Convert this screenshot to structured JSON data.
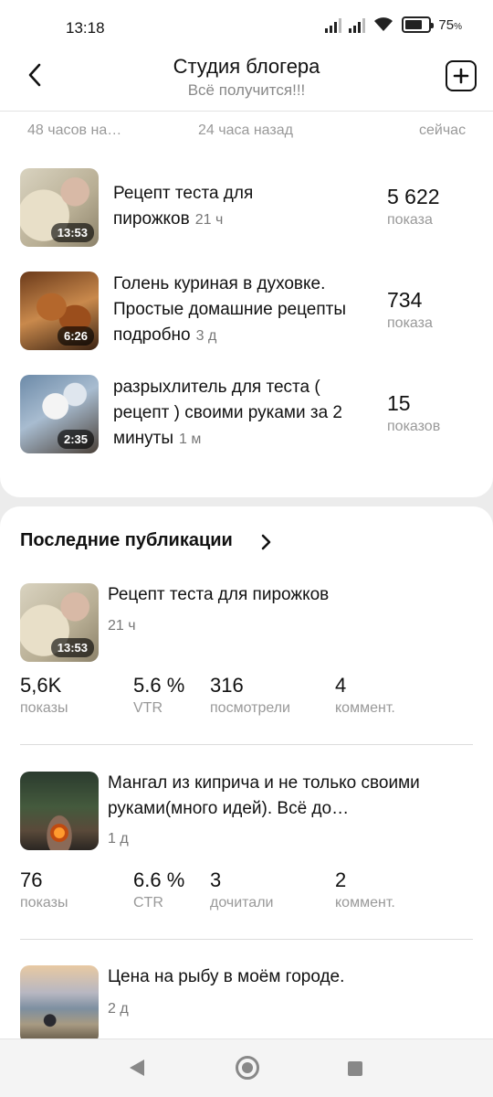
{
  "status": {
    "time": "13:18",
    "battery_value": "75",
    "battery_unit": "%",
    "battery_level": 0.75
  },
  "header": {
    "title": "Студия блогера",
    "subtitle": "Всё получится!!!"
  },
  "timeline": [
    "48 часов на…",
    "24 часа назад",
    "сейчас"
  ],
  "trending": [
    {
      "title_line1": "Рецепт теста для",
      "title_line2": "пирожков",
      "age": "21 ч",
      "value": "5 622",
      "unit": "показа",
      "duration": "13:53",
      "thumb": "dough"
    },
    {
      "title_line1": "Голень куриная в духовке.",
      "title_line2": "Простые домашние рецепты",
      "title_line3": "подробно",
      "age": "3 д",
      "value": "734",
      "unit": "показа",
      "duration": "6:26",
      "thumb": "chicken"
    },
    {
      "title_line1": "разрыхлитель для теста (",
      "title_line2": "рецепт ) своими руками за 2",
      "title_line3": "минуты",
      "age": "1 м",
      "value": "15",
      "unit": "показов",
      "duration": "2:35",
      "thumb": "powder"
    }
  ],
  "publications": {
    "title": "Последние публикации",
    "items": [
      {
        "title": "Рецепт теста для пирожков",
        "age": "21 ч",
        "duration": "13:53",
        "stats": [
          {
            "value": "5,6K",
            "label": "показы"
          },
          {
            "value": "5.6 %",
            "label": "VTR"
          },
          {
            "value": "316",
            "label": "посмотрели"
          },
          {
            "value": "4",
            "label": "коммент."
          }
        ]
      },
      {
        "title_line1": "Мангал из киприча и не только своими",
        "title_line2": "руками(много идей). Всё до…",
        "age": "1 д",
        "stats": [
          {
            "value": "76",
            "label": "показы"
          },
          {
            "value": "6.6 %",
            "label": "CTR"
          },
          {
            "value": "3",
            "label": "дочитали"
          },
          {
            "value": "2",
            "label": "коммент."
          }
        ]
      },
      {
        "title": "Цена на рыбу в моём городе.",
        "age": "2 д"
      }
    ]
  }
}
